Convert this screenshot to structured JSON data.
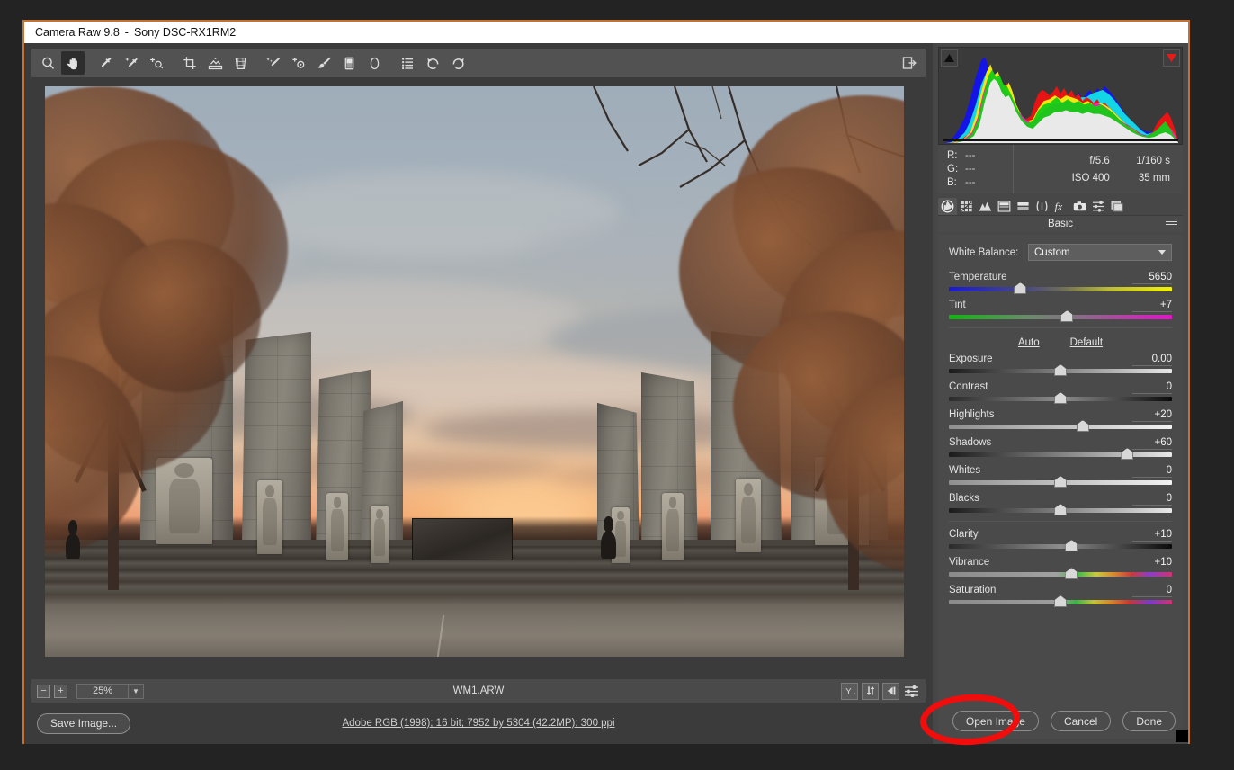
{
  "window": {
    "title_app": "Camera Raw 9.8",
    "title_sep": "-",
    "title_file": "Sony DSC-RX1RM2",
    "accent_border": "#c4722f",
    "desktop_bg": "#232323"
  },
  "toolbar": {
    "tools": [
      {
        "name": "zoom-tool",
        "label": "Zoom Tool",
        "active": false
      },
      {
        "name": "hand-tool",
        "label": "Hand Tool",
        "active": true
      },
      {
        "name": "white-balance-tool",
        "label": "White Balance Tool",
        "active": false
      },
      {
        "name": "color-sampler-tool",
        "label": "Color Sampler Tool",
        "active": false
      },
      {
        "name": "targeted-adjustment-tool",
        "label": "Targeted Adjustment Tool",
        "active": false
      },
      {
        "name": "crop-tool",
        "label": "Crop Tool",
        "active": false
      },
      {
        "name": "straighten-tool",
        "label": "Straighten Tool",
        "active": false
      },
      {
        "name": "transform-tool",
        "label": "Transform Tool",
        "active": false
      },
      {
        "name": "spot-removal-tool",
        "label": "Spot Removal",
        "active": false
      },
      {
        "name": "red-eye-removal-tool",
        "label": "Red Eye Removal",
        "active": false
      },
      {
        "name": "adjustment-brush-tool",
        "label": "Adjustment Brush",
        "active": false
      },
      {
        "name": "graduated-filter-tool",
        "label": "Graduated Filter",
        "active": false
      },
      {
        "name": "radial-filter-tool",
        "label": "Radial Filter",
        "active": false
      },
      {
        "name": "presets-tool",
        "label": "Presets",
        "active": false
      },
      {
        "name": "rotate-counterclockwise-tool",
        "label": "Rotate Image Counterclockwise",
        "active": false
      },
      {
        "name": "rotate-clockwise-tool",
        "label": "Rotate Image Clockwise",
        "active": false
      }
    ],
    "open_preferences_label": "Open Preferences Dialog"
  },
  "histogram": {
    "shadow_clipping_label": "Shadow clipping warning",
    "highlight_clipping_label": "Highlight clipping warning",
    "highlight_clipping_color": "#e81a1a",
    "shadow_clipping_color": "#0d0d0d",
    "highlight_clipping_active": true,
    "shadow_clipping_active": false
  },
  "exif": {
    "r_label": "R:",
    "g_label": "G:",
    "b_label": "B:",
    "r_value": "---",
    "g_value": "---",
    "b_value": "---",
    "aperture": "f/5.6",
    "shutter": "1/160 s",
    "iso": "ISO 400",
    "focal_length": "35 mm"
  },
  "panel_tabs": [
    {
      "name": "tab-basic",
      "label": "Basic",
      "active": true
    },
    {
      "name": "tab-tone-curve",
      "label": "Tone Curve",
      "active": false
    },
    {
      "name": "tab-detail",
      "label": "Detail",
      "active": false
    },
    {
      "name": "tab-hsl-grayscale",
      "label": "HSL / Grayscale",
      "active": false
    },
    {
      "name": "tab-split-toning",
      "label": "Split Toning",
      "active": false
    },
    {
      "name": "tab-lens-corrections",
      "label": "Lens Corrections",
      "active": false
    },
    {
      "name": "tab-effects",
      "label": "Effects",
      "active": false
    },
    {
      "name": "tab-camera-calibration",
      "label": "Camera Calibration",
      "active": false
    },
    {
      "name": "tab-presets",
      "label": "Presets",
      "active": false
    },
    {
      "name": "tab-snapshots",
      "label": "Snapshots",
      "active": false
    }
  ],
  "panel": {
    "title": "Basic",
    "menu_label": "Panel Menu",
    "white_balance_label": "White Balance:",
    "white_balance_value": "Custom",
    "auto_label": "Auto",
    "default_label": "Default",
    "sliders": [
      {
        "name": "temperature",
        "label": "Temperature",
        "value": "5650",
        "pos": 32
      },
      {
        "name": "tint",
        "label": "Tint",
        "value": "+7",
        "pos": 53
      },
      {
        "name": "exposure",
        "label": "Exposure",
        "value": "0.00",
        "pos": 50
      },
      {
        "name": "contrast",
        "label": "Contrast",
        "value": "0",
        "pos": 50
      },
      {
        "name": "highlights",
        "label": "Highlights",
        "value": "+20",
        "pos": 60
      },
      {
        "name": "shadows",
        "label": "Shadows",
        "value": "+60",
        "pos": 80
      },
      {
        "name": "whites",
        "label": "Whites",
        "value": "0",
        "pos": 50
      },
      {
        "name": "blacks",
        "label": "Blacks",
        "value": "0",
        "pos": 50
      },
      {
        "name": "clarity",
        "label": "Clarity",
        "value": "+10",
        "pos": 55
      },
      {
        "name": "vibrance",
        "label": "Vibrance",
        "value": "+10",
        "pos": 55
      },
      {
        "name": "saturation",
        "label": "Saturation",
        "value": "0",
        "pos": 50
      }
    ]
  },
  "status_bar": {
    "zoom_out_label": "−",
    "zoom_in_label": "+",
    "zoom_value": "25%",
    "filename": "WM1.ARW",
    "buttons": [
      {
        "name": "preview-toggle-button",
        "label": "Y"
      },
      {
        "name": "full-screen-toggle-button",
        "label": "Toggle Full Screen Mode"
      },
      {
        "name": "previous-image-button",
        "label": "Previous Image"
      },
      {
        "name": "filmstrip-settings-button",
        "label": "Filmstrip Settings"
      }
    ]
  },
  "footer": {
    "save_image_label": "Save Image...",
    "workflow_options": "Adobe RGB (1998); 16 bit; 7952 by 5304 (42.2MP); 300 ppi",
    "open_image_label": "Open Image",
    "cancel_label": "Cancel",
    "done_label": "Done"
  },
  "annotation": {
    "shape": "ellipse",
    "color": "#f20d0d",
    "target": "Open Image"
  },
  "photo": {
    "subject": "Virginia Tech War Memorial Pylons at sunset",
    "file": "WM1.ARW"
  }
}
